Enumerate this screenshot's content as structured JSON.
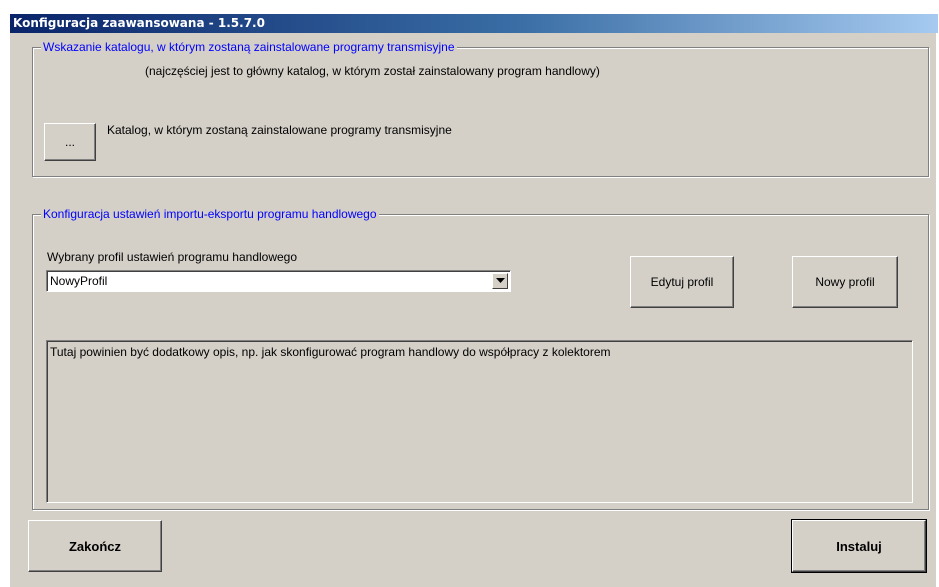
{
  "window": {
    "title": "Konfiguracja zaawansowana - 1.5.7.0"
  },
  "catalog_group": {
    "legend": "Wskazanie katalogu, w którym zostaną zainstalowane programy transmisyjne",
    "hint": "(najczęściej jest to główny katalog, w którym został zainstalowany program handlowy)",
    "browse_label": "...",
    "path_label": "Katalog, w którym zostaną zainstalowane programy transmisyjne"
  },
  "profile_group": {
    "legend": "Konfiguracja ustawień importu-eksportu programu handlowego",
    "profile_label": "Wybrany profil ustawień programu handlowego",
    "profile_value": "NowyProfil",
    "edit_label": "Edytuj profil",
    "new_label": "Nowy profil",
    "description": "Tutaj powinien być dodatkowy opis, np. jak skonfigurować program handlowy do współpracy z kolektorem"
  },
  "footer": {
    "close_label": "Zakończ",
    "install_label": "Instaluj"
  },
  "icons": {
    "dropdown": "chevron-down-icon"
  },
  "colors": {
    "legend": "#0000ff",
    "face": "#d4d0c8",
    "title_start": "#0a246a",
    "title_end": "#a6caf0"
  }
}
